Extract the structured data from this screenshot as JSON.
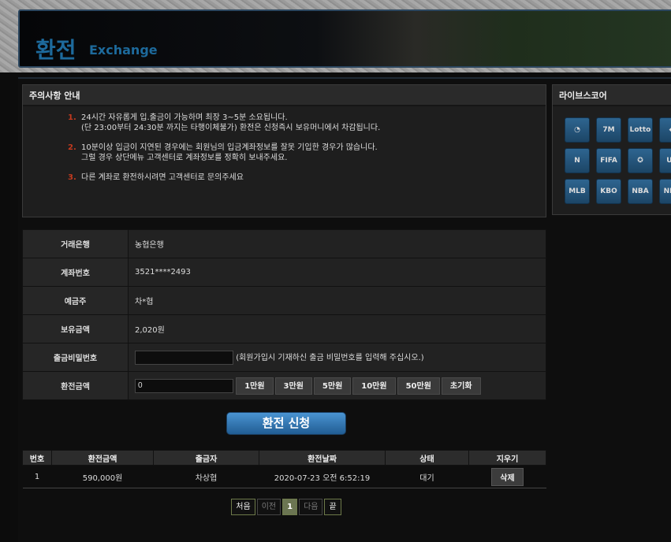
{
  "header": {
    "title_ko": "환전",
    "title_en": "Exchange"
  },
  "notice": {
    "title": "주의사항 안내",
    "items": [
      {
        "num": "1.",
        "text": "24시간 자유롭게 입.출금이 가능하며 최장 3~5분 소요됩니다.\n(단 23:00부터 24:30분 까지는 타행이체불가) 환전은 신청즉시 보유머니에서 차감됩니다."
      },
      {
        "num": "2.",
        "text": "10분이상 입금이 지연된 경우에는 회원님의 입금계좌정보를 잘못 기입한 경우가 많습니다.\n그럴 경우 상단메뉴 고객센터로 계좌정보를 정확히 보내주세요."
      },
      {
        "num": "3.",
        "text": "다른 계좌로 환전하시려면 고객센터로 문의주세요"
      }
    ]
  },
  "livescore": {
    "title": "라이브스코어",
    "icons": [
      {
        "name": "livescore-icon",
        "label": "◔"
      },
      {
        "name": "7m-icon",
        "label": "7M"
      },
      {
        "name": "lotto-icon",
        "label": "Lotto"
      },
      {
        "name": "partial-icon",
        "label": "◆"
      },
      {
        "name": "naver-icon",
        "label": "N"
      },
      {
        "name": "fifa-icon",
        "label": "FIFA"
      },
      {
        "name": "champions-league-icon",
        "label": "✪"
      },
      {
        "name": "uefa-icon",
        "label": "UE"
      },
      {
        "name": "mlb-icon",
        "label": "MLB"
      },
      {
        "name": "kbo-icon",
        "label": "KBO"
      },
      {
        "name": "nba-icon",
        "label": "NBA"
      },
      {
        "name": "nhl-icon",
        "label": "NHL"
      }
    ]
  },
  "form": {
    "bank_label": "거래은행",
    "bank": "농협은행",
    "account_label": "계좌번호",
    "account": "3521****2493",
    "holder_label": "예금주",
    "holder": "차*협",
    "balance_label": "보유금액",
    "balance": "2,020원",
    "password_label": "출금비밀번호",
    "password_hint": "(회원가입시 기재하신 출금 비밀번호를 입력해 주십시오.)",
    "amount_label": "환전금액",
    "amount_value": "0",
    "quick": [
      "1만원",
      "3만원",
      "5만원",
      "10만원",
      "50만원",
      "초기화"
    ]
  },
  "submit_label": "환전 신청",
  "history": {
    "columns": [
      "번호",
      "환전금액",
      "출금자",
      "환전날짜",
      "상태",
      "지우기"
    ],
    "rows": [
      {
        "no": "1",
        "amount": "590,000원",
        "name": "차상협",
        "date": "2020-07-23 오전 6:52:19",
        "status": "대기",
        "delete": "삭제"
      }
    ]
  },
  "pager": {
    "first": "처음",
    "prev": "이전",
    "current": "1",
    "next": "다음",
    "last": "끝"
  },
  "colors": {
    "accent": "#1d6a9c",
    "notice_number": "#c23a1f",
    "button": "#215d93"
  }
}
